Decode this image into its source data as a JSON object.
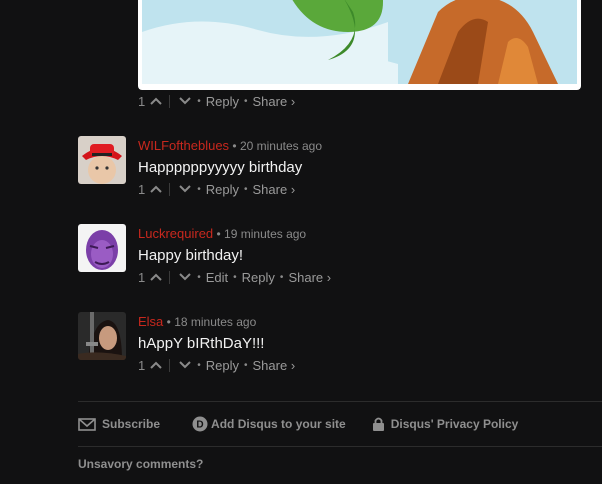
{
  "top_comment": {
    "votes": "1",
    "actions": {
      "reply": "Reply",
      "share": "Share ›"
    }
  },
  "comments": [
    {
      "author": "WILFoftheblues",
      "time": "20 minutes ago",
      "text": "Happppppyyyyy birthday",
      "votes": "1",
      "actions": {
        "reply": "Reply",
        "share": "Share ›"
      }
    },
    {
      "author": "Luckrequired",
      "time": "19 minutes ago",
      "text": "Happy birthday!",
      "votes": "1",
      "actions": {
        "edit": "Edit",
        "reply": "Reply",
        "share": "Share ›"
      }
    },
    {
      "author": "Elsa",
      "time": "18 minutes ago",
      "text": "hAppY bIRthDaY!!!",
      "votes": "1",
      "actions": {
        "reply": "Reply",
        "share": "Share ›"
      }
    }
  ],
  "footer": {
    "subscribe": "Subscribe",
    "add_disqus": "Add Disqus to your site",
    "privacy": "Disqus' Privacy Policy"
  },
  "section_title": "Unsavory comments?",
  "colors": {
    "background": "#111112",
    "author": "#c8281e",
    "muted": "#8a8a8a"
  }
}
